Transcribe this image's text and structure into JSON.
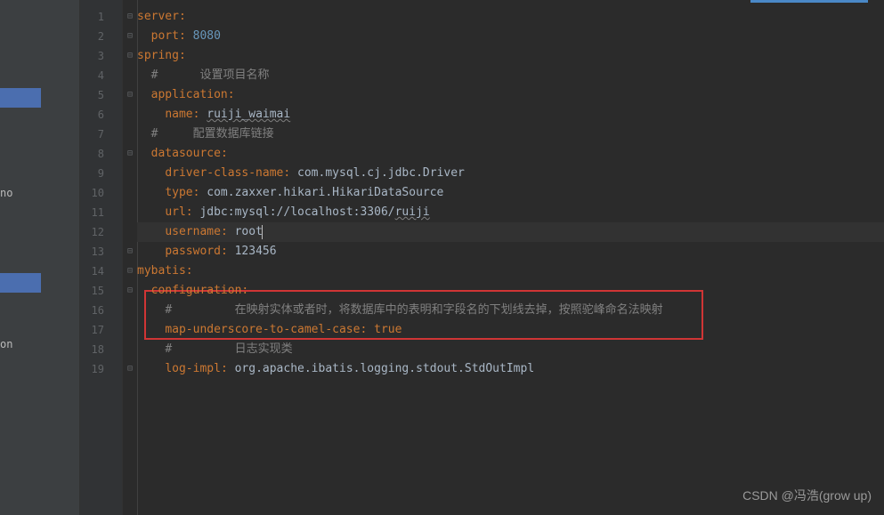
{
  "leftPanel": {
    "label1": "no",
    "label2": "on"
  },
  "lineNumbers": [
    "1",
    "2",
    "3",
    "4",
    "5",
    "6",
    "7",
    "8",
    "9",
    "10",
    "11",
    "12",
    "13",
    "14",
    "15",
    "16",
    "17",
    "18",
    "19"
  ],
  "foldMarkers": [
    "⊟",
    "⊟",
    "⊟",
    "",
    "⊟",
    "",
    "",
    "⊟",
    "",
    "",
    "",
    "",
    "⊟",
    "⊟",
    "⊟",
    "",
    "",
    "",
    "⊟"
  ],
  "code": {
    "l1": {
      "k": "server",
      "p": ":"
    },
    "l2": {
      "k": "port",
      "p": ": ",
      "v": "8080"
    },
    "l3": {
      "k": "spring",
      "p": ":"
    },
    "l4": {
      "c": "#      设置项目名称"
    },
    "l5": {
      "k": "application",
      "p": ":"
    },
    "l6": {
      "k": "name",
      "p": ": ",
      "v": "ruiji_waimai"
    },
    "l7": {
      "c": "#     配置数据库链接"
    },
    "l8": {
      "k": "datasource",
      "p": ":"
    },
    "l9": {
      "k": "driver-class-name",
      "p": ": ",
      "v": "com.mysql.cj.jdbc.Driver"
    },
    "l10": {
      "k": "type",
      "p": ": ",
      "v": "com.zaxxer.hikari.HikariDataSource"
    },
    "l11": {
      "k": "url",
      "p": ": ",
      "v1": "jdbc:mysql://localhost:3306/",
      "v2": "ruiji"
    },
    "l12": {
      "k": "username",
      "p": ": ",
      "v": "root"
    },
    "l13": {
      "k": "password",
      "p": ": ",
      "v": "123456"
    },
    "l14": {
      "k": "mybatis",
      "p": ":"
    },
    "l15": {
      "k": "configuration",
      "p": ":"
    },
    "l16": {
      "c": "#         在映射实体或者时，将数据库中的表明和字段名的下划线去掉，按照驼峰命名法映射"
    },
    "l17": {
      "k": "map-underscore-to-camel-case",
      "p": ": ",
      "v": "true"
    },
    "l18": {
      "c": "#         日志实现类"
    },
    "l19": {
      "k": "log-impl",
      "p": ": ",
      "v": "org.apache.ibatis.logging.stdout.StdOutImpl"
    }
  },
  "watermark": "CSDN @冯浩(grow up)"
}
